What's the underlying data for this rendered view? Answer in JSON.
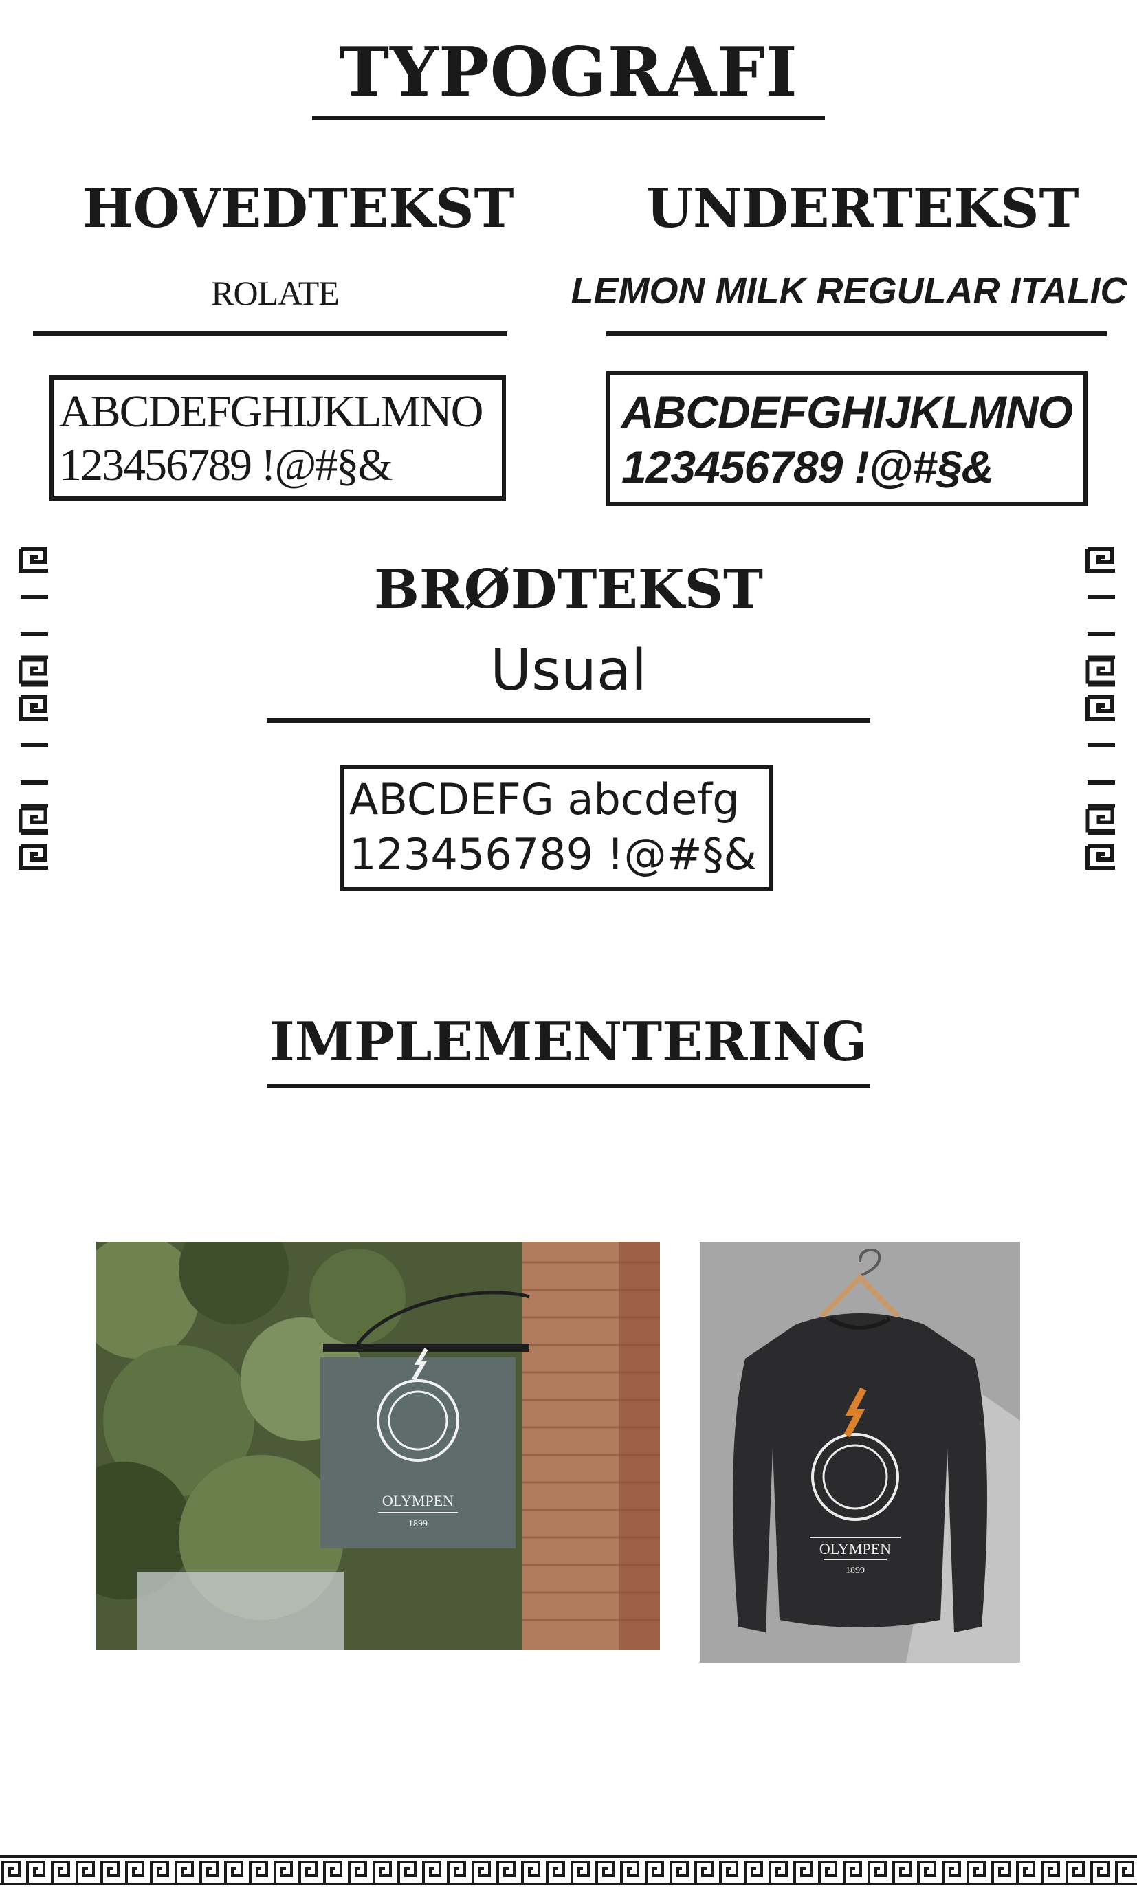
{
  "header": {
    "title": "TYPOGRAFI"
  },
  "columns": {
    "left": {
      "title": "HOVEDTEKST",
      "font_name": "ROLATE",
      "sample_line1": "ABCDEFGHIJKLMNO",
      "sample_line2": "123456789 !@#§&"
    },
    "right": {
      "title": "UNDERTEKST",
      "font_name": "LEMON MILK REGULAR ITALIC",
      "sample_line1": "ABCDEFGHIJKLMNO",
      "sample_line2": "123456789 !@#§&"
    }
  },
  "body_text": {
    "title": "BRØDTEKST",
    "font_name": "Usual",
    "sample_line1": "ABCDEFG abcdefg",
    "sample_line2": "123456789 !@#§&"
  },
  "implementation": {
    "title": "IMPLEMENTERING",
    "sign_logo": {
      "name": "OLYMPEN",
      "year": "1899"
    },
    "shirt_logo": {
      "name": "OLYMPEN",
      "year": "1899"
    }
  },
  "icons": {
    "meander": "greek-key-icon",
    "bolt": "lightning-bolt-icon",
    "apple": "apple-logo-icon",
    "hanger": "hanger-icon"
  },
  "colors": {
    "ink": "#1b1a1a",
    "background": "#ffffff",
    "sign_board": "#5f6c6c",
    "sweater": "#2b2b2d",
    "bolt_orange": "#d9822b",
    "shirt_backdrop": "#a6a6a6"
  }
}
